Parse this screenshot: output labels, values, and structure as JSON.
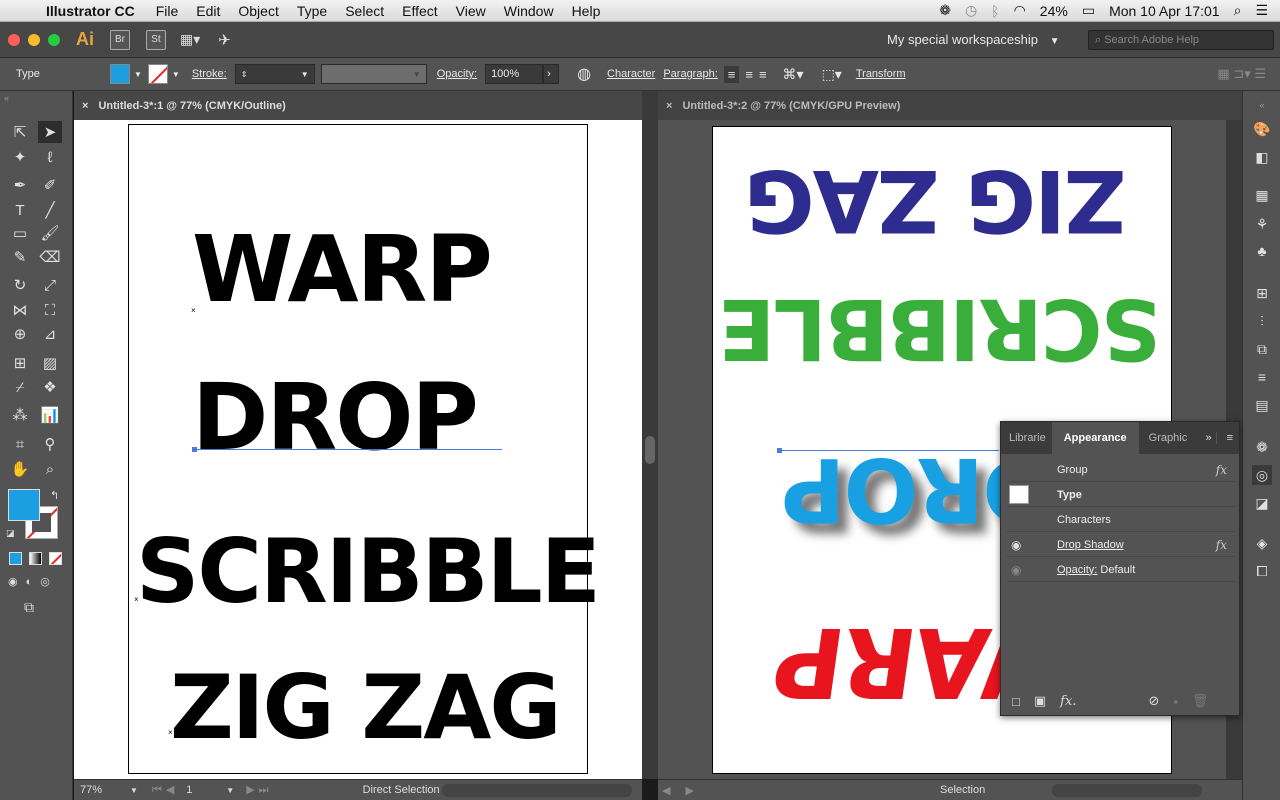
{
  "menubar": {
    "app": "Illustrator CC",
    "items": [
      "File",
      "Edit",
      "Object",
      "Type",
      "Select",
      "Effect",
      "View",
      "Window",
      "Help"
    ],
    "battery": "24%",
    "datetime": "Mon 10 Apr  17:01"
  },
  "appbar": {
    "logo": "Ai",
    "br": "Br",
    "st": "St",
    "workspace": "My special workspaceship",
    "search_placeholder": "Search Adobe Help"
  },
  "control": {
    "type_label": "Type",
    "stroke_label": "Stroke:",
    "opacity_label": "Opacity:",
    "opacity_value": "100%",
    "character": "Character",
    "paragraph": "Paragraph:",
    "transform": "Transform",
    "fill_color": "#1c9fe0"
  },
  "docs": [
    {
      "tab": "Untitled-3*:1 @ 77% (CMYK/Outline)",
      "zoom": "77%",
      "page": "1",
      "status": "Direct Selection"
    },
    {
      "tab": "Untitled-3*:2 @ 77% (CMYK/GPU Preview)",
      "status": "Selection"
    }
  ],
  "artwork": {
    "warp": "WARP",
    "drop": "DROP",
    "scribble": "SCRIBBLE",
    "zigzag": "ZIG ZAG",
    "warp_color": "#e8141e",
    "drop_color": "#18a0e2",
    "scribble_color": "#3aae3a",
    "zigzag_color": "#2f2c8f"
  },
  "appearance": {
    "tabs": [
      "Librarie",
      "Appearance",
      "Graphic"
    ],
    "rows": [
      {
        "label": "Group",
        "fx": "fx"
      },
      {
        "label": "Type"
      },
      {
        "label": "Characters"
      },
      {
        "label": "Drop Shadow",
        "fx": "fx"
      },
      {
        "label": "Opacity:",
        "value": "Default"
      }
    ]
  }
}
